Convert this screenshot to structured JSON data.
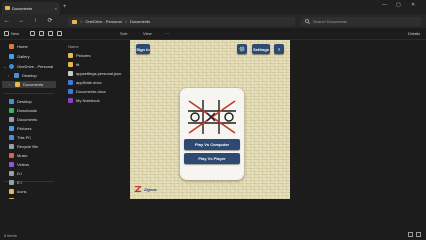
{
  "window": {
    "tab_title": "Documents",
    "tab_close": "×",
    "new_tab": "+",
    "controls": [
      "—",
      "▢",
      "✕"
    ]
  },
  "navigation": {
    "buttons": [
      "←",
      "→",
      "↑",
      "⟳"
    ],
    "breadcrumb": [
      "OneDrive - Personal",
      "Documents"
    ],
    "separator": ">",
    "search_placeholder": "Search Documents"
  },
  "command_bar": {
    "new_label": "New",
    "sort_label": "Sort",
    "view_label": "View",
    "more_label": "···",
    "details_label": "Details"
  },
  "sidebar": {
    "items": [
      {
        "label": "Home",
        "icon": "home-icon",
        "color": "#e0763a"
      },
      {
        "label": "Gallery",
        "icon": "gallery-icon",
        "color": "#4a9de0"
      },
      {
        "label": "OneDrive - Personal",
        "icon": "cloud-icon",
        "color": "#3b8fd9"
      },
      {
        "label": "Desktop",
        "icon": "folder-icon",
        "color": "#4a90d9"
      },
      {
        "label": "Documents",
        "icon": "folder-icon",
        "color": "#e8b84a"
      },
      {
        "label": "Desktop",
        "icon": "desktop-icon",
        "color": "#4a90d9"
      },
      {
        "label": "Downloads",
        "icon": "download-icon",
        "color": "#3fae6a"
      },
      {
        "label": "Documents",
        "icon": "document-icon",
        "color": "#9aa0a8"
      },
      {
        "label": "Pictures",
        "icon": "picture-icon",
        "color": "#4a9de0"
      },
      {
        "label": "This PC",
        "icon": "pc-icon",
        "color": "#4a90d9"
      },
      {
        "label": "Recycle Bin",
        "icon": "recycle-icon",
        "color": "#9aa0a8"
      },
      {
        "label": "Music",
        "icon": "music-icon",
        "color": "#e0604a"
      },
      {
        "label": "Videos",
        "icon": "video-icon",
        "color": "#8a5ad9"
      },
      {
        "label": "D:\\",
        "icon": "drive-icon",
        "color": "#9aa0a8"
      },
      {
        "label": "E:\\",
        "icon": "drive-icon",
        "color": "#9aa0a8"
      },
      {
        "label": "Icons",
        "icon": "folder-icon",
        "color": "#e8b84a"
      },
      {
        "label": "OneDrive",
        "icon": "folder-icon",
        "color": "#e8b84a"
      },
      {
        "label": "Project",
        "icon": "folder-icon",
        "color": "#e8b84a"
      },
      {
        "label": "Work",
        "icon": "folder-icon",
        "color": "#e8b84a"
      }
    ]
  },
  "file_list": {
    "header": "Name",
    "items": [
      {
        "label": "Pictures",
        "icon": "folder-icon",
        "color": "#e8b84a"
      },
      {
        "label": "ttt",
        "icon": "folder-icon",
        "color": "#e8b84a"
      },
      {
        "label": "appsettings.personal.json",
        "icon": "file-icon",
        "color": "#c9c9c9"
      },
      {
        "label": "appState.docx",
        "icon": "file-icon",
        "color": "#3b7bd9"
      },
      {
        "label": "Documents.docx",
        "icon": "file-icon",
        "color": "#3b7bd9"
      },
      {
        "label": "My Notebook",
        "icon": "notebook-icon",
        "color": "#8a3fc9"
      }
    ]
  },
  "game": {
    "sign_in_label": "Sign in",
    "settings_label": "Settings",
    "help_label": "?",
    "play_computer_label": "Play Vs Computer",
    "play_player_label": "Play Vs Player",
    "brand_label": "Zignas",
    "colors": {
      "panel": "#e4ddb8",
      "button": "#2e4a73",
      "card": "#f6f5f1"
    }
  },
  "status": {
    "items_text": "6 items"
  }
}
